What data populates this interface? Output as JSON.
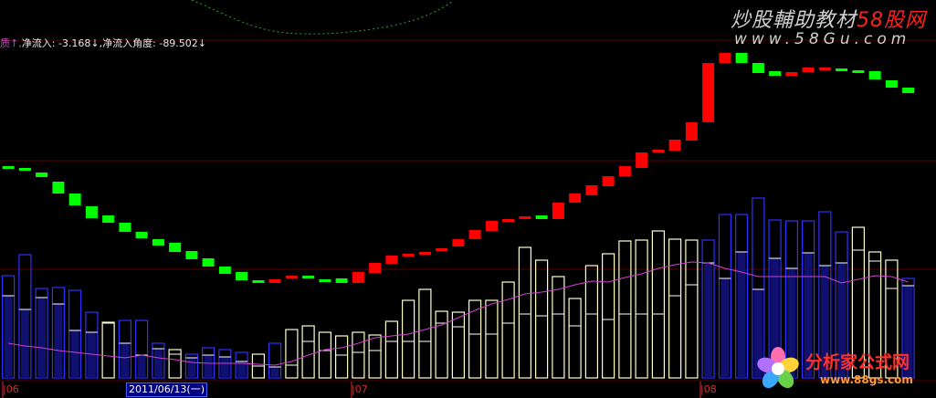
{
  "indicator_header": {
    "prefix": "质↑,",
    "flow_label": "净流入:",
    "flow_value": "-3.168↓",
    "angle_label": "净流入角度:",
    "angle_value": "-89.502↓"
  },
  "watermark": {
    "line1_cn": "炒股輔助教材",
    "line1_red": "58股网",
    "line2": "www.58Gu.com"
  },
  "logo": {
    "name": "分析家公式网",
    "url": "www.88gs.com"
  },
  "x_axis": {
    "labels": [
      "|06",
      "|07",
      "|08"
    ],
    "cursor_date": "2011/06/13(一)"
  },
  "colors": {
    "background": "#000000",
    "up_candle": "#ff0000",
    "down_candle": "#00ff00",
    "volume_up": "#ffffcc",
    "volume_down": "#3030ff",
    "moving_average": "#d040d0",
    "grid": "#5a0000"
  },
  "chart_data": {
    "type": "bar",
    "panes": [
      "indicator-blocks",
      "volume"
    ],
    "indicator_blocks": [
      {
        "open": 182,
        "close": 182,
        "dir": "down"
      },
      {
        "open": 184,
        "close": 187,
        "dir": "down"
      },
      {
        "open": 189,
        "close": 194,
        "dir": "down"
      },
      {
        "open": 199,
        "close": 212,
        "dir": "down"
      },
      {
        "open": 212,
        "close": 225,
        "dir": "down"
      },
      {
        "open": 226,
        "close": 239,
        "dir": "down"
      },
      {
        "open": 236,
        "close": 244,
        "dir": "down"
      },
      {
        "open": 244,
        "close": 254,
        "dir": "down"
      },
      {
        "open": 254,
        "close": 261,
        "dir": "down"
      },
      {
        "open": 262,
        "close": 269,
        "dir": "down"
      },
      {
        "open": 266,
        "close": 276,
        "dir": "down"
      },
      {
        "open": 275,
        "close": 284,
        "dir": "down"
      },
      {
        "open": 283,
        "close": 292,
        "dir": "down"
      },
      {
        "open": 292,
        "close": 300,
        "dir": "down"
      },
      {
        "open": 298,
        "close": 307,
        "dir": "down"
      },
      {
        "open": 307,
        "close": 310,
        "dir": "down"
      },
      {
        "open": 310,
        "close": 306,
        "dir": "up"
      },
      {
        "open": 305,
        "close": 302,
        "dir": "up"
      },
      {
        "open": 302,
        "close": 304,
        "dir": "down"
      },
      {
        "open": 306,
        "close": 307,
        "dir": "down"
      },
      {
        "open": 305,
        "close": 310,
        "dir": "down"
      },
      {
        "open": 310,
        "close": 298,
        "dir": "up"
      },
      {
        "open": 299,
        "close": 288,
        "dir": "up"
      },
      {
        "open": 289,
        "close": 280,
        "dir": "up"
      },
      {
        "open": 281,
        "close": 278,
        "dir": "up"
      },
      {
        "open": 278,
        "close": 276,
        "dir": "up"
      },
      {
        "open": 275,
        "close": 272,
        "dir": "up"
      },
      {
        "open": 270,
        "close": 262,
        "dir": "up"
      },
      {
        "open": 262,
        "close": 252,
        "dir": "up"
      },
      {
        "open": 253,
        "close": 242,
        "dir": "up"
      },
      {
        "open": 243,
        "close": 240,
        "dir": "up"
      },
      {
        "open": 240,
        "close": 237,
        "dir": "up"
      },
      {
        "open": 236,
        "close": 240,
        "dir": "down"
      },
      {
        "open": 240,
        "close": 222,
        "dir": "up"
      },
      {
        "open": 222,
        "close": 212,
        "dir": "up"
      },
      {
        "open": 214,
        "close": 203,
        "dir": "up"
      },
      {
        "open": 204,
        "close": 193,
        "dir": "up"
      },
      {
        "open": 193,
        "close": 182,
        "dir": "up"
      },
      {
        "open": 184,
        "close": 167,
        "dir": "up"
      },
      {
        "open": 167,
        "close": 164,
        "dir": "up"
      },
      {
        "open": 165,
        "close": 153,
        "dir": "up"
      },
      {
        "open": 154,
        "close": 134,
        "dir": "up"
      },
      {
        "open": 134,
        "close": 69,
        "dir": "up"
      },
      {
        "open": 69,
        "close": 58,
        "dir": "up"
      },
      {
        "open": 58,
        "close": 69,
        "dir": "down"
      },
      {
        "open": 69,
        "close": 80,
        "dir": "down"
      },
      {
        "open": 78,
        "close": 83,
        "dir": "down"
      },
      {
        "open": 83,
        "close": 79,
        "dir": "up"
      },
      {
        "open": 79,
        "close": 74,
        "dir": "up"
      },
      {
        "open": 74,
        "close": 74,
        "dir": "up"
      },
      {
        "open": 75,
        "close": 76,
        "dir": "down"
      },
      {
        "open": 77,
        "close": 77,
        "dir": "down"
      },
      {
        "open": 78,
        "close": 87,
        "dir": "down"
      },
      {
        "open": 88,
        "close": 96,
        "dir": "down"
      },
      {
        "open": 96,
        "close": 102,
        "dir": "down"
      }
    ],
    "volume": [
      {
        "v": 112,
        "m": 90,
        "up": false
      },
      {
        "v": 135,
        "m": 75,
        "up": false
      },
      {
        "v": 98,
        "m": 88,
        "up": false
      },
      {
        "v": 99,
        "m": 81,
        "up": false
      },
      {
        "v": 96,
        "m": 52,
        "up": false
      },
      {
        "v": 72,
        "m": 50,
        "up": false
      },
      {
        "v": 61,
        "m": 60,
        "up": true
      },
      {
        "v": 63,
        "m": 38,
        "up": false
      },
      {
        "v": 63,
        "m": 25,
        "up": false
      },
      {
        "v": 38,
        "m": 32,
        "up": false
      },
      {
        "v": 31,
        "m": 26,
        "up": true
      },
      {
        "v": 26,
        "m": 22,
        "up": false
      },
      {
        "v": 33,
        "m": 25,
        "up": false
      },
      {
        "v": 31,
        "m": 23,
        "up": false
      },
      {
        "v": 28,
        "m": 18,
        "up": false
      },
      {
        "v": 26,
        "m": 13,
        "up": true
      },
      {
        "v": 38,
        "m": 12,
        "up": false
      },
      {
        "v": 53,
        "m": 14,
        "up": true
      },
      {
        "v": 57,
        "m": 40,
        "up": true
      },
      {
        "v": 50,
        "m": 30,
        "up": true
      },
      {
        "v": 46,
        "m": 25,
        "up": true
      },
      {
        "v": 50,
        "m": 28,
        "up": true
      },
      {
        "v": 47,
        "m": 30,
        "up": true
      },
      {
        "v": 62,
        "m": 40,
        "up": true
      },
      {
        "v": 85,
        "m": 40,
        "up": true
      },
      {
        "v": 97,
        "m": 40,
        "up": true
      },
      {
        "v": 73,
        "m": 60,
        "up": true
      },
      {
        "v": 72,
        "m": 56,
        "up": true
      },
      {
        "v": 85,
        "m": 48,
        "up": true
      },
      {
        "v": 85,
        "m": 48,
        "up": true
      },
      {
        "v": 105,
        "m": 60,
        "up": true
      },
      {
        "v": 143,
        "m": 70,
        "up": true
      },
      {
        "v": 129,
        "m": 68,
        "up": true
      },
      {
        "v": 111,
        "m": 70,
        "up": true
      },
      {
        "v": 87,
        "m": 57,
        "up": true
      },
      {
        "v": 123,
        "m": 70,
        "up": true
      },
      {
        "v": 136,
        "m": 64,
        "up": true
      },
      {
        "v": 150,
        "m": 70,
        "up": true
      },
      {
        "v": 151,
        "m": 70,
        "up": true
      },
      {
        "v": 161,
        "m": 70,
        "up": true
      },
      {
        "v": 152,
        "m": 90,
        "up": true
      },
      {
        "v": 151,
        "m": 102,
        "up": true
      },
      {
        "v": 151,
        "m": 126,
        "up": false
      },
      {
        "v": 179,
        "m": 109,
        "up": false
      },
      {
        "v": 179,
        "m": 138,
        "up": false
      },
      {
        "v": 197,
        "m": 97,
        "up": false
      },
      {
        "v": 173,
        "m": 131,
        "up": false
      },
      {
        "v": 172,
        "m": 120,
        "up": false
      },
      {
        "v": 172,
        "m": 137,
        "up": false
      },
      {
        "v": 182,
        "m": 123,
        "up": false
      },
      {
        "v": 160,
        "m": 126,
        "up": false
      },
      {
        "v": 165,
        "m": 140,
        "up": true
      },
      {
        "v": 138,
        "m": 128,
        "up": true
      },
      {
        "v": 129,
        "m": 98,
        "up": true
      },
      {
        "v": 109,
        "m": 101,
        "up": false
      }
    ],
    "volume_ma": [
      38,
      35,
      33,
      30,
      28,
      26,
      24,
      22,
      25,
      22,
      20,
      17,
      16,
      16,
      16,
      15,
      14,
      18,
      25,
      31,
      33,
      38,
      44,
      46,
      48,
      53,
      58,
      66,
      74,
      81,
      86,
      92,
      94,
      97,
      102,
      106,
      105,
      110,
      114,
      120,
      124,
      127,
      126,
      120,
      116,
      111,
      111,
      111,
      111,
      111,
      104,
      108,
      112,
      111,
      105
    ]
  }
}
